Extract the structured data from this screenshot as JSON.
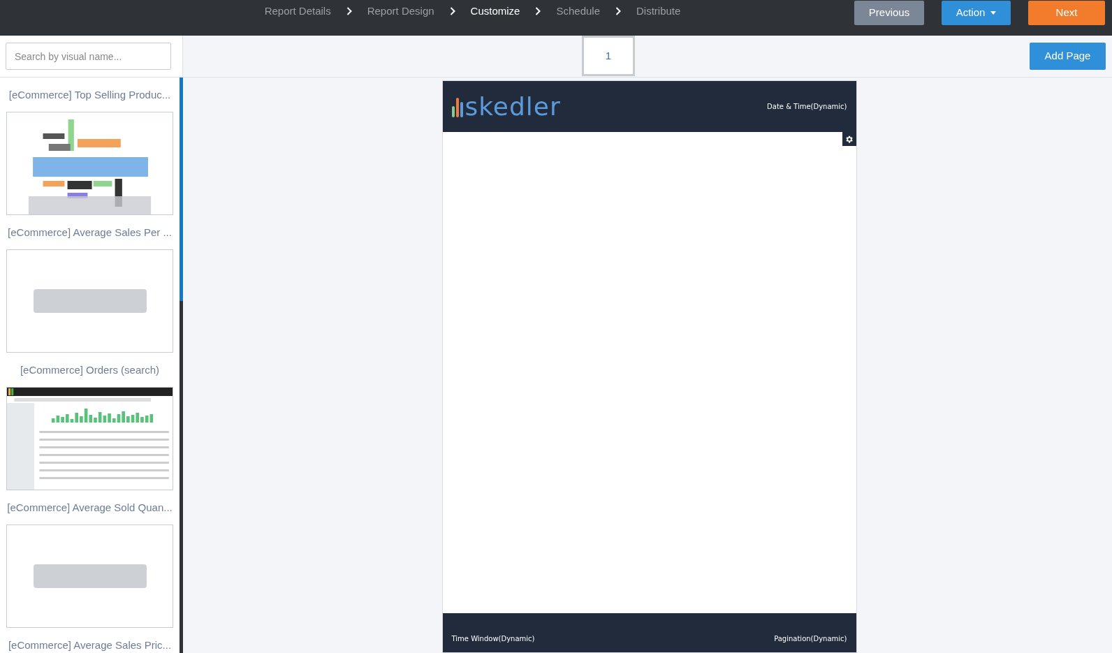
{
  "steps": [
    {
      "label": "Report Details",
      "selected": false
    },
    {
      "label": "Report Design",
      "selected": false
    },
    {
      "label": "Customize",
      "selected": true
    },
    {
      "label": "Schedule",
      "selected": false
    },
    {
      "label": "Distribute",
      "selected": false
    }
  ],
  "buttons": [
    {
      "label": "Previous",
      "kind": "secondary"
    },
    {
      "label": "Action",
      "kind": "dropdown"
    },
    {
      "label": "Next",
      "kind": "primary"
    }
  ],
  "search": {
    "placeholder": "Search by visual name..."
  },
  "pages": [
    {
      "label": "1",
      "selected": true
    }
  ],
  "add_page": "Add Page",
  "visuals": [
    {
      "title": "[eCommerce] Top Selling Produc...",
      "kind": "picture"
    },
    {
      "title": "[eCommerce] Average Sales Per ...",
      "kind": "placeholder"
    },
    {
      "title": "[eCommerce] Orders (search)",
      "kind": "picture"
    },
    {
      "title": "[eCommerce] Average Sold Quan...",
      "kind": "placeholder"
    },
    {
      "title": "[eCommerce] Average Sales Pric..."
    }
  ],
  "report": {
    "logo": "skedler",
    "header_right": "Date & Time(Dynamic)",
    "footer_left": "Time Window(Dynamic)",
    "footer_right": "Pagination(Dynamic)"
  }
}
